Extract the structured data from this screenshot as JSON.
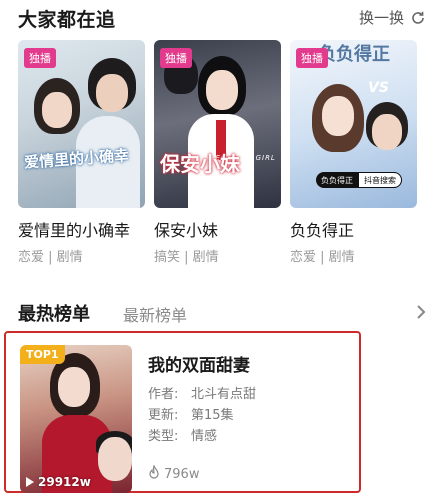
{
  "section": {
    "title": "大家都在追",
    "refresh_label": "换一换"
  },
  "cards": [
    {
      "badge": "独播",
      "poster_text": "爱情里的小确幸",
      "title": "爱情里的小确幸",
      "tags": "恋爱 | 剧情"
    },
    {
      "badge": "独播",
      "poster_text": "保安小妹",
      "poster_subtext": "SECURITY GIRL",
      "title": "保安小妹",
      "tags": "搞笑 | 剧情"
    },
    {
      "badge": "独播",
      "poster_text": "负负得正",
      "poster_vs": "VS",
      "poster_tag_left": "负负得正",
      "poster_tag_right": "抖音搜索",
      "title": "负负得正",
      "tags": "恋爱 | 剧情"
    }
  ],
  "ranking": {
    "tab_active": "最热榜单",
    "tab_inactive": "最新榜单",
    "item": {
      "rank_badge": "TOP1",
      "play_count": "29912w",
      "title": "我的双面甜妻",
      "author_label": "作者:",
      "author": "北斗有点甜",
      "update_label": "更新:",
      "update": "第15集",
      "type_label": "类型:",
      "type": "情感",
      "hot_count": "796w"
    }
  },
  "colors": {
    "badge": "#e23a8c",
    "highlight_border": "#cf2a2a",
    "top_badge": "#f3b01b"
  },
  "icons": [
    "refresh-icon",
    "chevron-right-icon",
    "play-icon",
    "flame-icon"
  ]
}
